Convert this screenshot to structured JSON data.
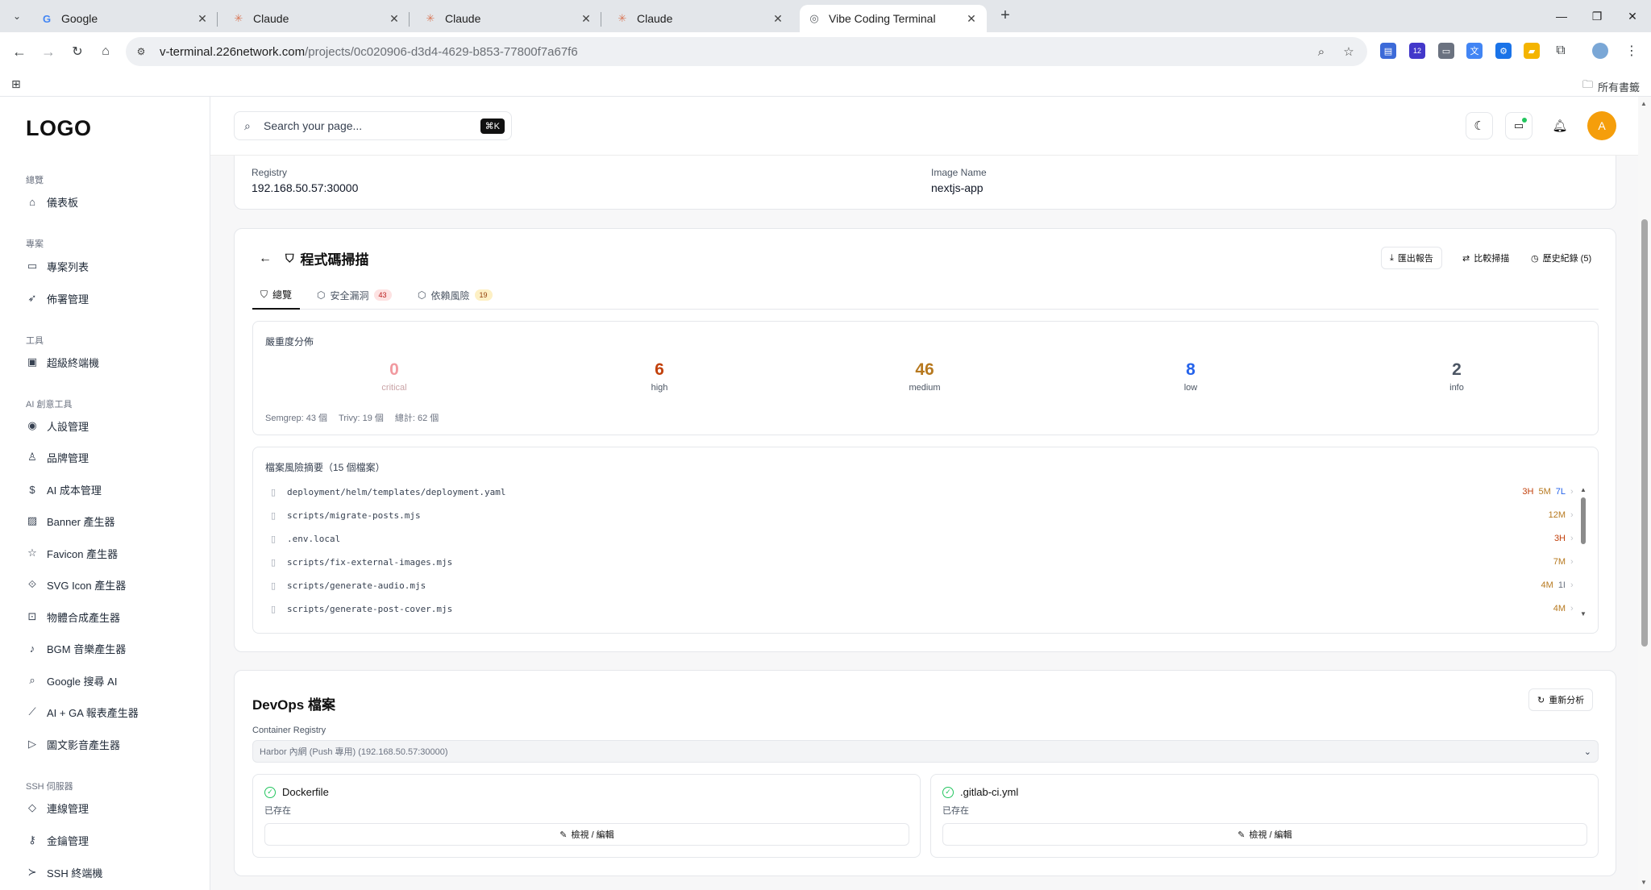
{
  "browser": {
    "tabs": [
      {
        "title": "Google",
        "favicon": "G"
      },
      {
        "title": "Claude",
        "favicon": "✳"
      },
      {
        "title": "Claude",
        "favicon": "✳"
      },
      {
        "title": "Claude",
        "favicon": "✳"
      },
      {
        "title": "Vibe Coding Terminal",
        "favicon": "◎"
      }
    ],
    "url_host": "v-terminal.226network.com",
    "url_path": "/projects/0c020906-d3d4-4629-b853-77800f7a67f6",
    "extension_badge": "12",
    "bookmarks_all": "所有書籤"
  },
  "app": {
    "logo": "LOGO",
    "search_placeholder": "Search your page...",
    "search_shortcut": "⌘K",
    "avatar_initial": "A"
  },
  "sidebar": {
    "groups": [
      {
        "label": "總覽",
        "items": [
          {
            "label": "儀表板",
            "icon": "home-icon"
          }
        ]
      },
      {
        "label": "專案",
        "items": [
          {
            "label": "專案列表",
            "icon": "folder-icon"
          },
          {
            "label": "佈署管理",
            "icon": "rocket-icon"
          }
        ]
      },
      {
        "label": "工具",
        "items": [
          {
            "label": "超級終端機",
            "icon": "terminal-icon"
          }
        ]
      },
      {
        "label": "AI 創意工具",
        "items": [
          {
            "label": "人設管理",
            "icon": "user-circle-icon"
          },
          {
            "label": "品牌管理",
            "icon": "brand-icon"
          },
          {
            "label": "AI 成本管理",
            "icon": "dollar-icon"
          },
          {
            "label": "Banner 產生器",
            "icon": "image-icon"
          },
          {
            "label": "Favicon 產生器",
            "icon": "star-icon"
          },
          {
            "label": "SVG Icon 產生器",
            "icon": "svg-icon"
          },
          {
            "label": "物體合成產生器",
            "icon": "scan-icon"
          },
          {
            "label": "BGM 音樂產生器",
            "icon": "music-icon"
          },
          {
            "label": "Google 搜尋 AI",
            "icon": "search-icon"
          },
          {
            "label": "AI + GA 報表產生器",
            "icon": "chart-icon"
          },
          {
            "label": "圖文影音產生器",
            "icon": "media-icon"
          }
        ]
      },
      {
        "label": "SSH 伺服器",
        "items": [
          {
            "label": "連線管理",
            "icon": "wifi-icon"
          },
          {
            "label": "金鑰管理",
            "icon": "key-icon"
          },
          {
            "label": "SSH 終端機",
            "icon": "terminal-icon"
          }
        ]
      }
    ]
  },
  "registry": {
    "registry_label": "Registry",
    "registry_value": "192.168.50.57:30000",
    "image_label": "Image Name",
    "image_value": "nextjs-app"
  },
  "scan": {
    "title": "程式碼掃描",
    "actions": {
      "export": "匯出報告",
      "compare": "比較掃描",
      "history": "歷史紀錄 (5)"
    },
    "tabs": [
      {
        "label": "總覽",
        "icon": "shield-icon"
      },
      {
        "label": "安全漏洞",
        "badge": "43",
        "icon": "box-icon"
      },
      {
        "label": "依賴風險",
        "badge": "19",
        "icon": "package-icon"
      }
    ],
    "severity_title": "嚴重度分佈",
    "severity": [
      {
        "value": "0",
        "label": "critical",
        "color": "#f19aa0"
      },
      {
        "value": "6",
        "label": "high",
        "color": "#c2410c"
      },
      {
        "value": "46",
        "label": "medium",
        "color": "#b7791f"
      },
      {
        "value": "8",
        "label": "low",
        "color": "#2563eb"
      },
      {
        "value": "2",
        "label": "info",
        "color": "#4b5563"
      }
    ],
    "summary": {
      "semgrep": "Semgrep: 43 個",
      "trivy": "Trivy: 19 個",
      "total": "總計: 62 個"
    },
    "files_title": "檔案風險摘要（15 個檔案）",
    "files": [
      {
        "path": "deployment/helm/templates/deployment.yaml",
        "tags": [
          {
            "t": "3H",
            "c": "#c2410c"
          },
          {
            "t": "5M",
            "c": "#b7791f"
          },
          {
            "t": "7L",
            "c": "#2563eb"
          }
        ]
      },
      {
        "path": "scripts/migrate-posts.mjs",
        "tags": [
          {
            "t": "12M",
            "c": "#b7791f"
          }
        ]
      },
      {
        "path": ".env.local",
        "tags": [
          {
            "t": "3H",
            "c": "#c2410c"
          }
        ]
      },
      {
        "path": "scripts/fix-external-images.mjs",
        "tags": [
          {
            "t": "7M",
            "c": "#b7791f"
          }
        ]
      },
      {
        "path": "scripts/generate-audio.mjs",
        "tags": [
          {
            "t": "4M",
            "c": "#b7791f"
          },
          {
            "t": "1I",
            "c": "#6b7280"
          }
        ]
      },
      {
        "path": "scripts/generate-post-cover.mjs",
        "tags": [
          {
            "t": "4M",
            "c": "#b7791f"
          }
        ]
      }
    ]
  },
  "devops": {
    "title": "DevOps 檔案",
    "reanalyze": "重新分析",
    "registry_label": "Container Registry",
    "registry_select": "Harbor 內網 (Push 專用) (192.168.50.57:30000)",
    "files": [
      {
        "name": "Dockerfile",
        "status": "已存在",
        "action": "檢視 / 編輯"
      },
      {
        "name": ".gitlab-ci.yml",
        "status": "已存在",
        "action": "檢視 / 編輯"
      }
    ]
  }
}
